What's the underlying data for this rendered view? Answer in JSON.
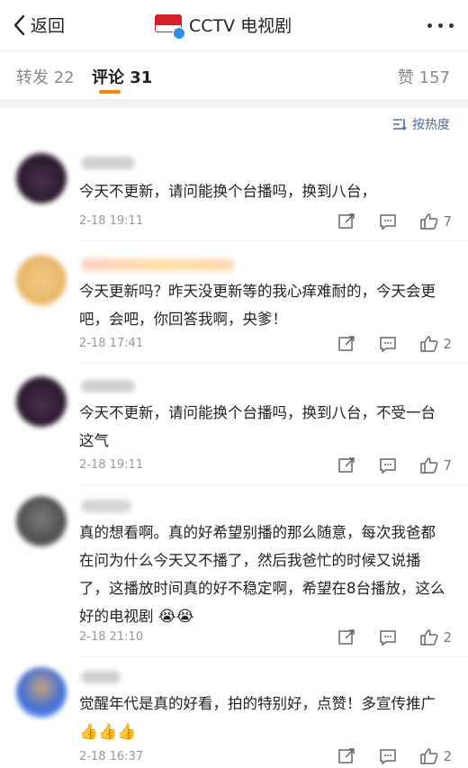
{
  "header": {
    "back_label": "返回",
    "title": "CCTV 电视剧"
  },
  "tabs": {
    "repost": "转发 22",
    "comments": "评论 31",
    "likes": "赞 157"
  },
  "sort": {
    "label": "按热度"
  },
  "comments": [
    {
      "text": "今天不更新，请问能换个台播吗，换到八台，",
      "time": "2-18 19:11",
      "likes": "7"
    },
    {
      "text": "今天更新吗？昨天没更新等的我心痒难耐的，今天会更吧，会吧，你回答我啊，央爹！",
      "time": "2-18 17:41",
      "likes": "2"
    },
    {
      "text": "今天不更新，请问能换个台播吗，换到八台，不受一台这气",
      "time": "2-18 19:11",
      "likes": "7"
    },
    {
      "text": "真的想看啊。真的好希望别播的那么随意，每次我爸都在问为什么今天又不播了，然后我爸忙的时候又说播了，这播放时间真的好不稳定啊，希望在8台播放，这么好的电视剧",
      "emoji": "😭😭",
      "time": "2-18 21:10",
      "likes": "2"
    },
    {
      "text": "觉醒年代是真的好看，拍的特别好，点赞！多宣传推广",
      "emoji": "👍👍👍",
      "time": "2-18 16:37",
      "likes": "2"
    }
  ],
  "colors": {
    "accent": "#ff8200",
    "link": "#4f6b9b",
    "meta": "#999999"
  }
}
